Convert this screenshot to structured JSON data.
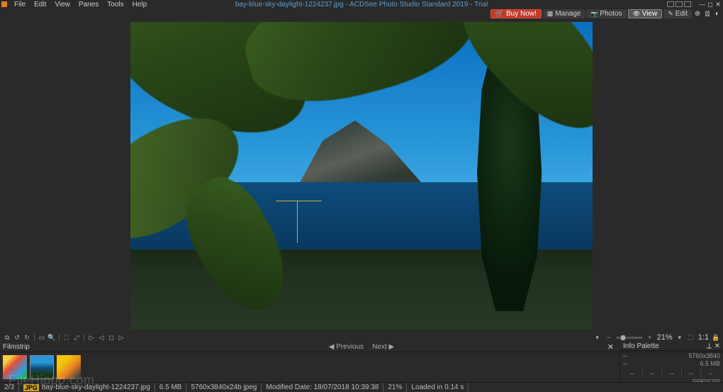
{
  "menubar": {
    "items": [
      "File",
      "Edit",
      "View",
      "Panes",
      "Tools",
      "Help"
    ],
    "title": "bay-blue-sky-daylight-1224237.jpg - ACDSee Photo Studio Standard 2019 - Trial"
  },
  "modebar": {
    "buy": "Buy Now!",
    "manage": "Manage",
    "photos": "Photos",
    "view": "View",
    "edit": "Edit"
  },
  "toolbar": {
    "zoom_pct": "21%",
    "ratio": "1:1"
  },
  "nav": {
    "filmstrip_label": "Filmstrip",
    "previous": "Previous",
    "next": "Next"
  },
  "info_palette": {
    "title": "Info Palette",
    "dims": "5760x3840",
    "size": "6.5 MB",
    "dash": "--",
    "cells": [
      "--",
      "--",
      "--",
      "--",
      "--"
    ]
  },
  "statusbar": {
    "index": "2/3",
    "ext_badge": "JPG",
    "filename": "bay-blue-sky-daylight-1224237.jpg",
    "size": "6.5 MB",
    "dims": "5760x3840x24b jpeg",
    "modified": "Modified Date: 18/07/2018 10:39:38",
    "zoom": "21%",
    "loaded": "Loaded in 0.14 s"
  },
  "watermark": "FileHippo.com"
}
